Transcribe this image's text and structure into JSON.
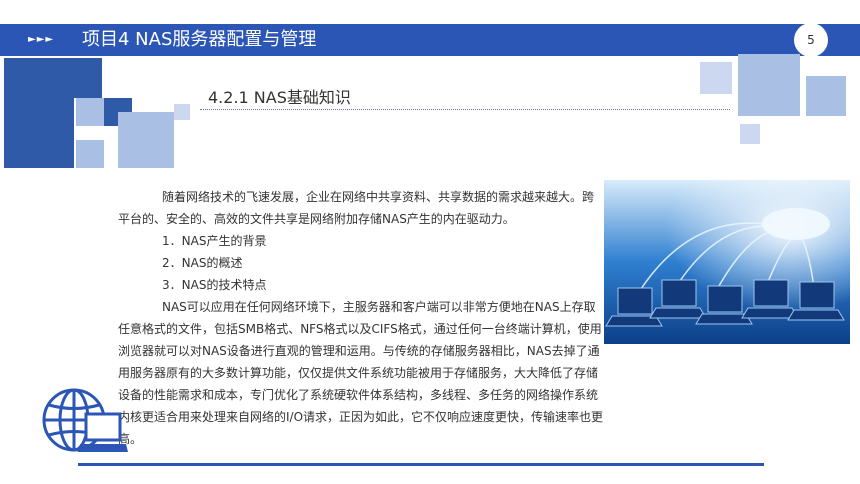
{
  "header": {
    "arrows": "►►►",
    "title": "项目4 NAS服务器配置与管理",
    "page_number": "5"
  },
  "section": {
    "subtitle": "4.2.1 NAS基础知识"
  },
  "body": {
    "intro": "随着网络技术的飞速发展，企业在网络中共享资料、共享数据的需求越来越大。跨平台的、安全的、高效的文件共享是网络附加存储NAS产生的内在驱动力。",
    "items": [
      "1．NAS产生的背景",
      "2．NAS的概述",
      "3．NAS的技术特点"
    ],
    "detail": "NAS可以应用在任何网络环境下，主服务器和客户端可以非常方便地在NAS上存取任意格式的文件，包括SMB格式、NFS格式以及CIFS格式，通过任何一台终端计算机，使用浏览器就可以对NAS设备进行直观的管理和运用。与传统的存储服务器相比，NAS去掉了通用服务器原有的大多数计算功能，仅仅提供文件系统功能被用于存储服务，大大降低了存储设备的性能需求和成本，专门优化了系统硬软件体系结构，多线程、多任务的网络操作系统内核更适合用来处理来自网络的I/O请求，正因为如此，它不仅响应速度更快，传输速率也更高。"
  },
  "colors": {
    "primary": "#2b56b5",
    "light": "#a9bfe3",
    "lighter": "#ccd8ef"
  },
  "icons": {
    "globe": "globe-laptop-icon",
    "illustration": "network-laptops-illustration"
  }
}
